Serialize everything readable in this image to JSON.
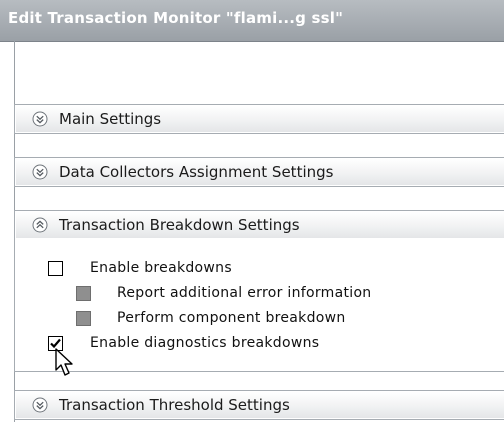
{
  "window": {
    "title": "Edit Transaction Monitor \"flami...g ssl\""
  },
  "sections": {
    "main": {
      "label": "Main Settings",
      "state": "collapsed"
    },
    "data_collectors": {
      "label": "Data Collectors Assignment Settings",
      "state": "collapsed"
    },
    "breakdown": {
      "label": "Transaction Breakdown Settings",
      "state": "expanded",
      "options": [
        {
          "label": "Enable breakdowns",
          "checked": false,
          "enabled": true
        },
        {
          "label": "Report additional error information",
          "checked": false,
          "enabled": false
        },
        {
          "label": "Perform component breakdown",
          "checked": false,
          "enabled": false
        },
        {
          "label": "Enable diagnostics breakdowns",
          "checked": true,
          "enabled": true
        }
      ]
    },
    "threshold": {
      "label": "Transaction Threshold Settings",
      "state": "collapsed"
    }
  },
  "icons": {
    "collapsed": "chevron-double-down-icon",
    "expanded": "chevron-double-up-icon",
    "pointer": "mouse-pointer-icon"
  },
  "colors": {
    "title_bar": "#a7acb1",
    "section_border": "#a6acb2",
    "disabled_checkbox": "#8f8f8f"
  }
}
